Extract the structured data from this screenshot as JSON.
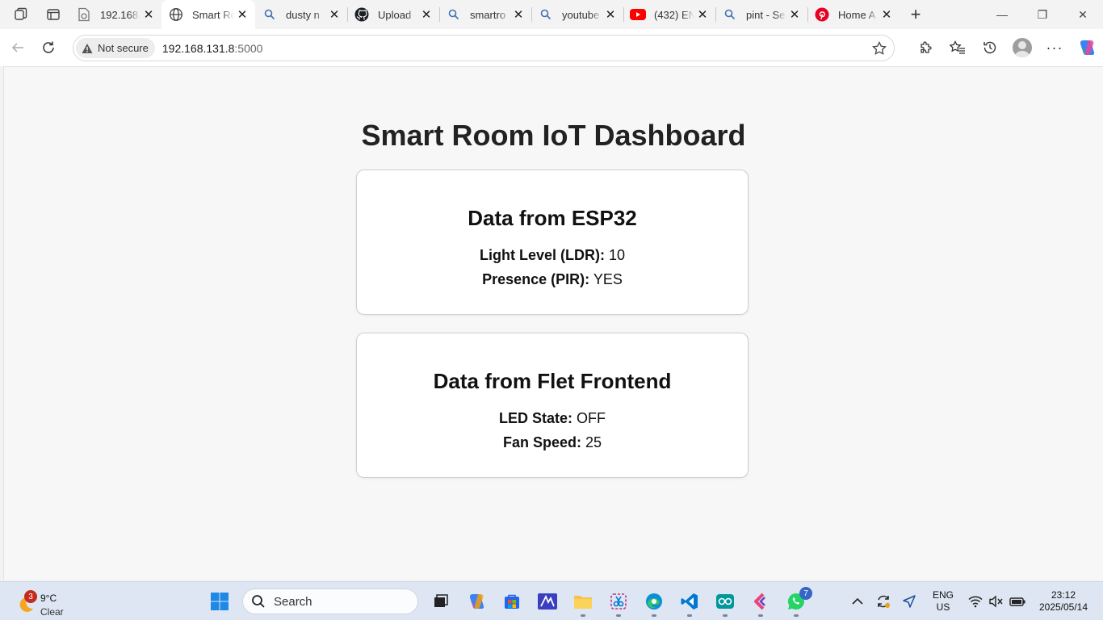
{
  "browser": {
    "tabs": [
      {
        "title": "192.168.",
        "icon": "document-icon",
        "active": false
      },
      {
        "title": "Smart Ro",
        "icon": "globe-icon",
        "active": true
      },
      {
        "title": "dusty n",
        "icon": "search-icon",
        "active": false
      },
      {
        "title": "Upload",
        "icon": "github-icon",
        "active": false
      },
      {
        "title": "smartro",
        "icon": "search-icon",
        "active": false
      },
      {
        "title": "youtube",
        "icon": "search-icon",
        "active": false
      },
      {
        "title": "(432) EN",
        "icon": "youtube-icon",
        "active": false
      },
      {
        "title": "pint - Se",
        "icon": "search-icon",
        "active": false
      },
      {
        "title": "Home A",
        "icon": "pinterest-icon",
        "active": false
      }
    ],
    "security_label": "Not secure",
    "url_host": "192.168.131.8",
    "url_port": ":5000"
  },
  "page": {
    "title": "Smart Room IoT Dashboard",
    "cards": [
      {
        "heading": "Data from ESP32",
        "rows": [
          {
            "label": "Light Level (LDR):",
            "value": "10"
          },
          {
            "label": "Presence (PIR):",
            "value": "YES"
          }
        ]
      },
      {
        "heading": "Data from Flet Frontend",
        "rows": [
          {
            "label": "LED State:",
            "value": "OFF"
          },
          {
            "label": "Fan Speed:",
            "value": "25"
          }
        ]
      }
    ]
  },
  "taskbar": {
    "weather_badge": "3",
    "temperature": "9°C",
    "condition": "Clear",
    "search_placeholder": "Search",
    "whatsapp_badge": "7",
    "language": "ENG",
    "region": "US",
    "time": "23:12",
    "date": "2025/05/14"
  },
  "colors": {
    "active_tab": "#ffffff",
    "tabstrip": "#f3f3f3",
    "page_bg": "#f7f7f7",
    "card_border": "#cfcfcf",
    "taskbar": "#dde6f2",
    "youtube_red": "#ff0000",
    "pinterest_red": "#e60023",
    "badge_red": "#c42b1c",
    "badge_blue": "#3566c7"
  }
}
